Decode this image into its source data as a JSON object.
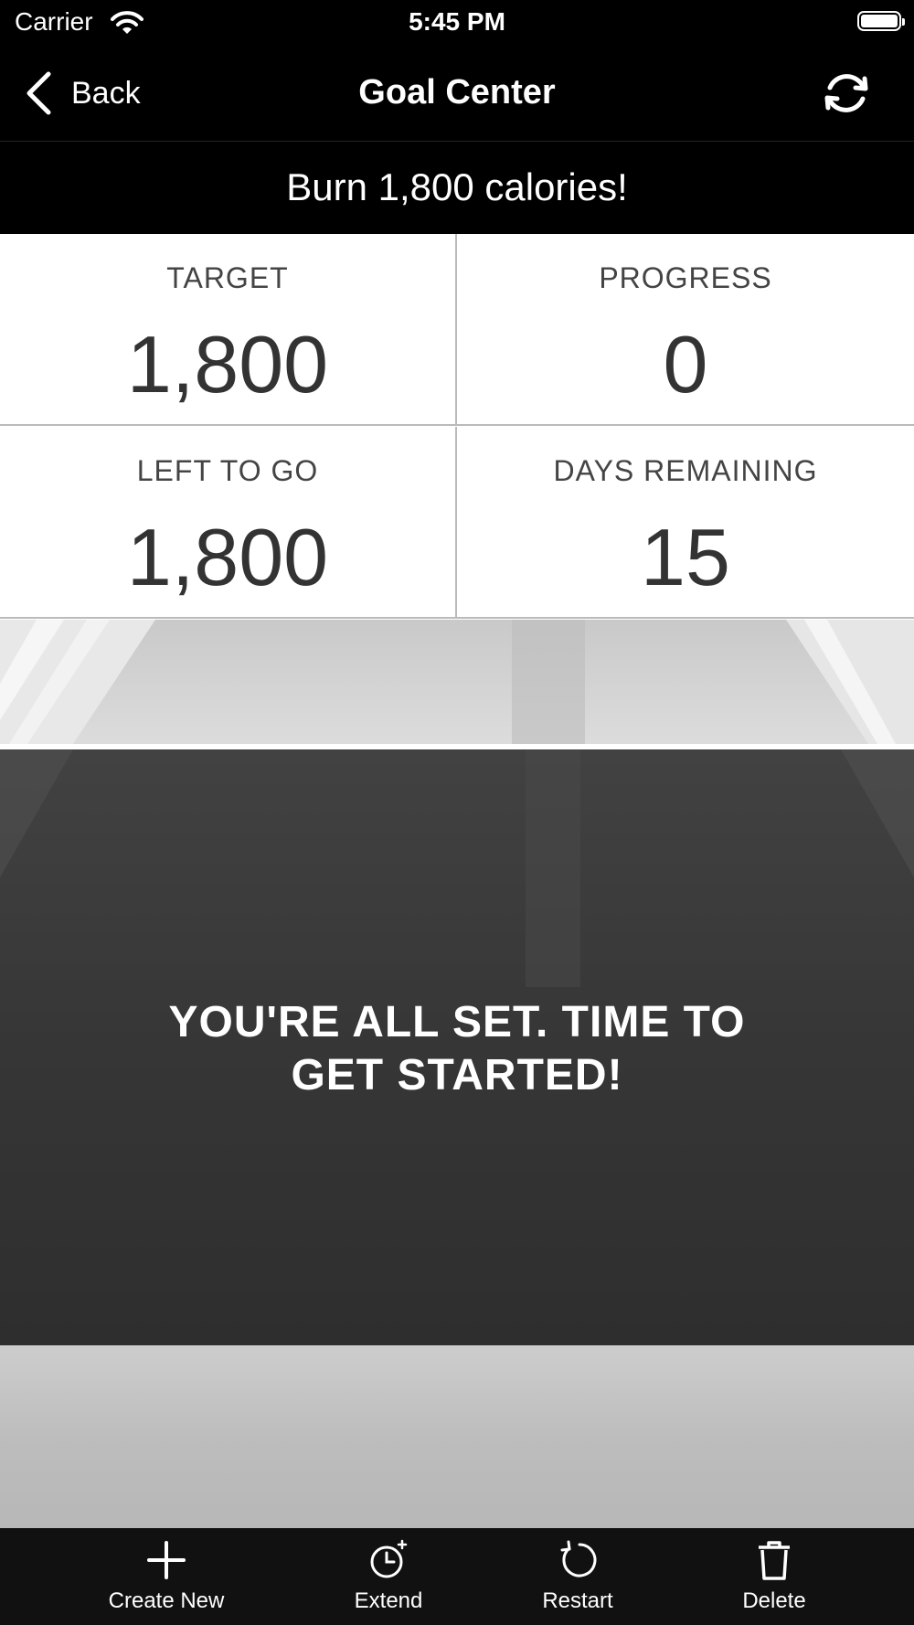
{
  "status_bar": {
    "carrier": "Carrier",
    "time": "5:45 PM"
  },
  "nav": {
    "back_label": "Back",
    "title": "Goal Center"
  },
  "goal": {
    "title": "Burn 1,800 calories!"
  },
  "stats": {
    "target": {
      "label": "TARGET",
      "value": "1,800"
    },
    "progress": {
      "label": "PROGRESS",
      "value": "0"
    },
    "left_to_go": {
      "label": "LEFT TO GO",
      "value": "1,800"
    },
    "days_remaining": {
      "label": "DAYS REMAINING",
      "value": "15"
    }
  },
  "message": {
    "line1": "YOU'RE ALL SET. TIME TO",
    "line2": "GET STARTED!"
  },
  "toolbar": {
    "create_new": "Create New",
    "extend": "Extend",
    "restart": "Restart",
    "delete": "Delete"
  },
  "icons": [
    "wifi-icon",
    "battery-icon",
    "chevron-left-icon",
    "refresh-icon",
    "plus-icon",
    "clock-icon",
    "restart-icon",
    "trash-icon"
  ]
}
